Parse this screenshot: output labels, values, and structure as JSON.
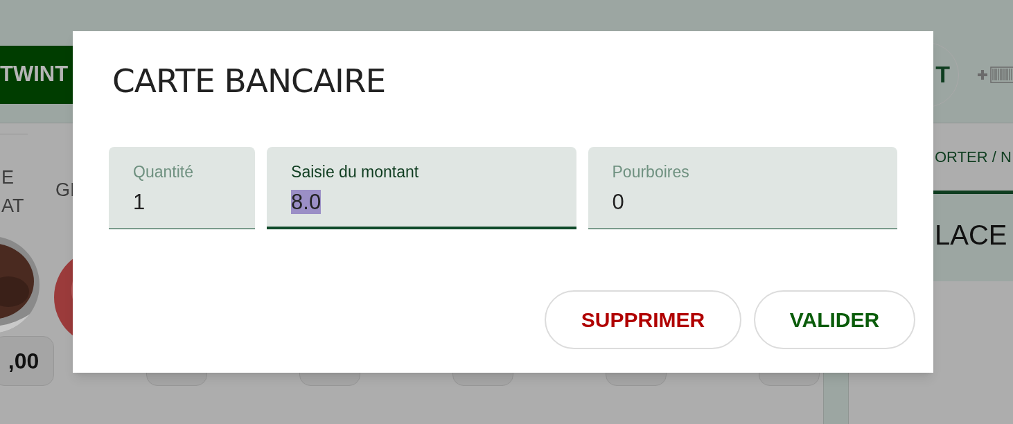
{
  "background": {
    "payment_button": "TWINT",
    "round_button": "T",
    "order_tab": {
      "label": "ORTER / N",
      "selected": true
    },
    "order_row": "LACE",
    "products": [
      {
        "kind": "full",
        "name_lines": [
          "E",
          "AT"
        ],
        "price": ",00"
      },
      {
        "kind": "full",
        "name_lines": [
          "GI"
        ]
      },
      {
        "kind": "tag_only"
      },
      {
        "kind": "tag_only"
      },
      {
        "kind": "tag_only"
      },
      {
        "kind": "tag_only"
      }
    ]
  },
  "dialog": {
    "title": "CARTE BANCAIRE",
    "fields": [
      {
        "label": "Quantité",
        "value": "1",
        "focused": false,
        "value_highlighted": false
      },
      {
        "label": "Saisie du montant",
        "value": "8.0",
        "focused": true,
        "value_highlighted": true
      },
      {
        "label": "Pourboires",
        "value": "0",
        "focused": false,
        "value_highlighted": false
      }
    ],
    "buttons": [
      {
        "label": "SUPPRIMER",
        "kind": "danger"
      },
      {
        "label": "VALIDER",
        "kind": "confirm"
      }
    ]
  }
}
